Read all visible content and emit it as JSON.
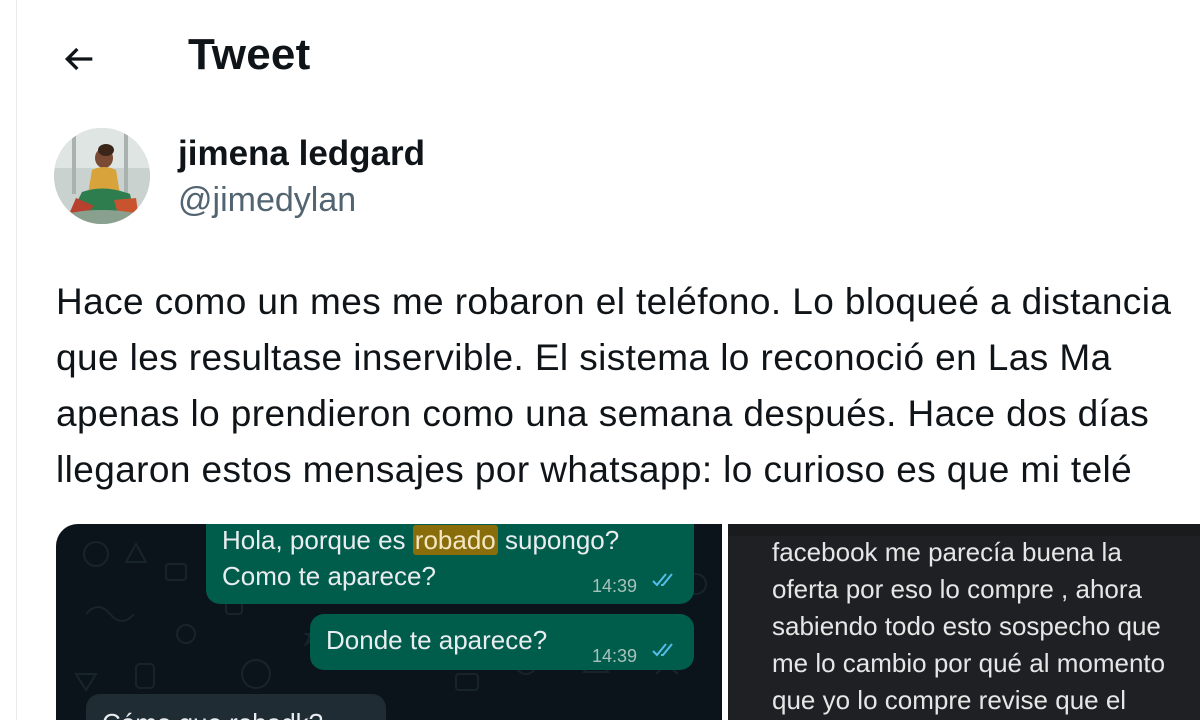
{
  "header": {
    "back_icon": "arrow-left-icon",
    "title": "Tweet"
  },
  "author": {
    "display_name": "jimena ledgard",
    "handle": "@jimedylan"
  },
  "tweet": {
    "lines": [
      "Hace como un mes me robaron el teléfono. Lo bloqueé a distancia",
      "que les resultase inservible.  El sistema lo reconoció en Las Ma",
      "apenas lo prendieron como una semana después. Hace dos días",
      "llegaron estos mensajes por whatsapp: lo curioso es que mi telé"
    ]
  },
  "media_left": {
    "bubble_1": {
      "prefix": "Hola, porque es ",
      "highlight": "robado",
      "suffix": " supongo?",
      "line2": "Como te aparece?",
      "time": "14:39"
    },
    "bubble_2": {
      "text": "Donde te aparece?",
      "time": "14:39"
    },
    "bubble_3": {
      "text": "Cómo que robadk?"
    },
    "colors": {
      "background": "#0b141a",
      "outgoing": "#005c4b",
      "incoming": "#202c33",
      "ticks": "#53bdeb"
    }
  },
  "media_right": {
    "lines": [
      "facebook me parecía buena la",
      "oferta por eso lo compre , ahora",
      "sabiendo todo esto sospecho que",
      "me lo cambio por qué al momento",
      "que yo lo compre revise que el"
    ]
  }
}
